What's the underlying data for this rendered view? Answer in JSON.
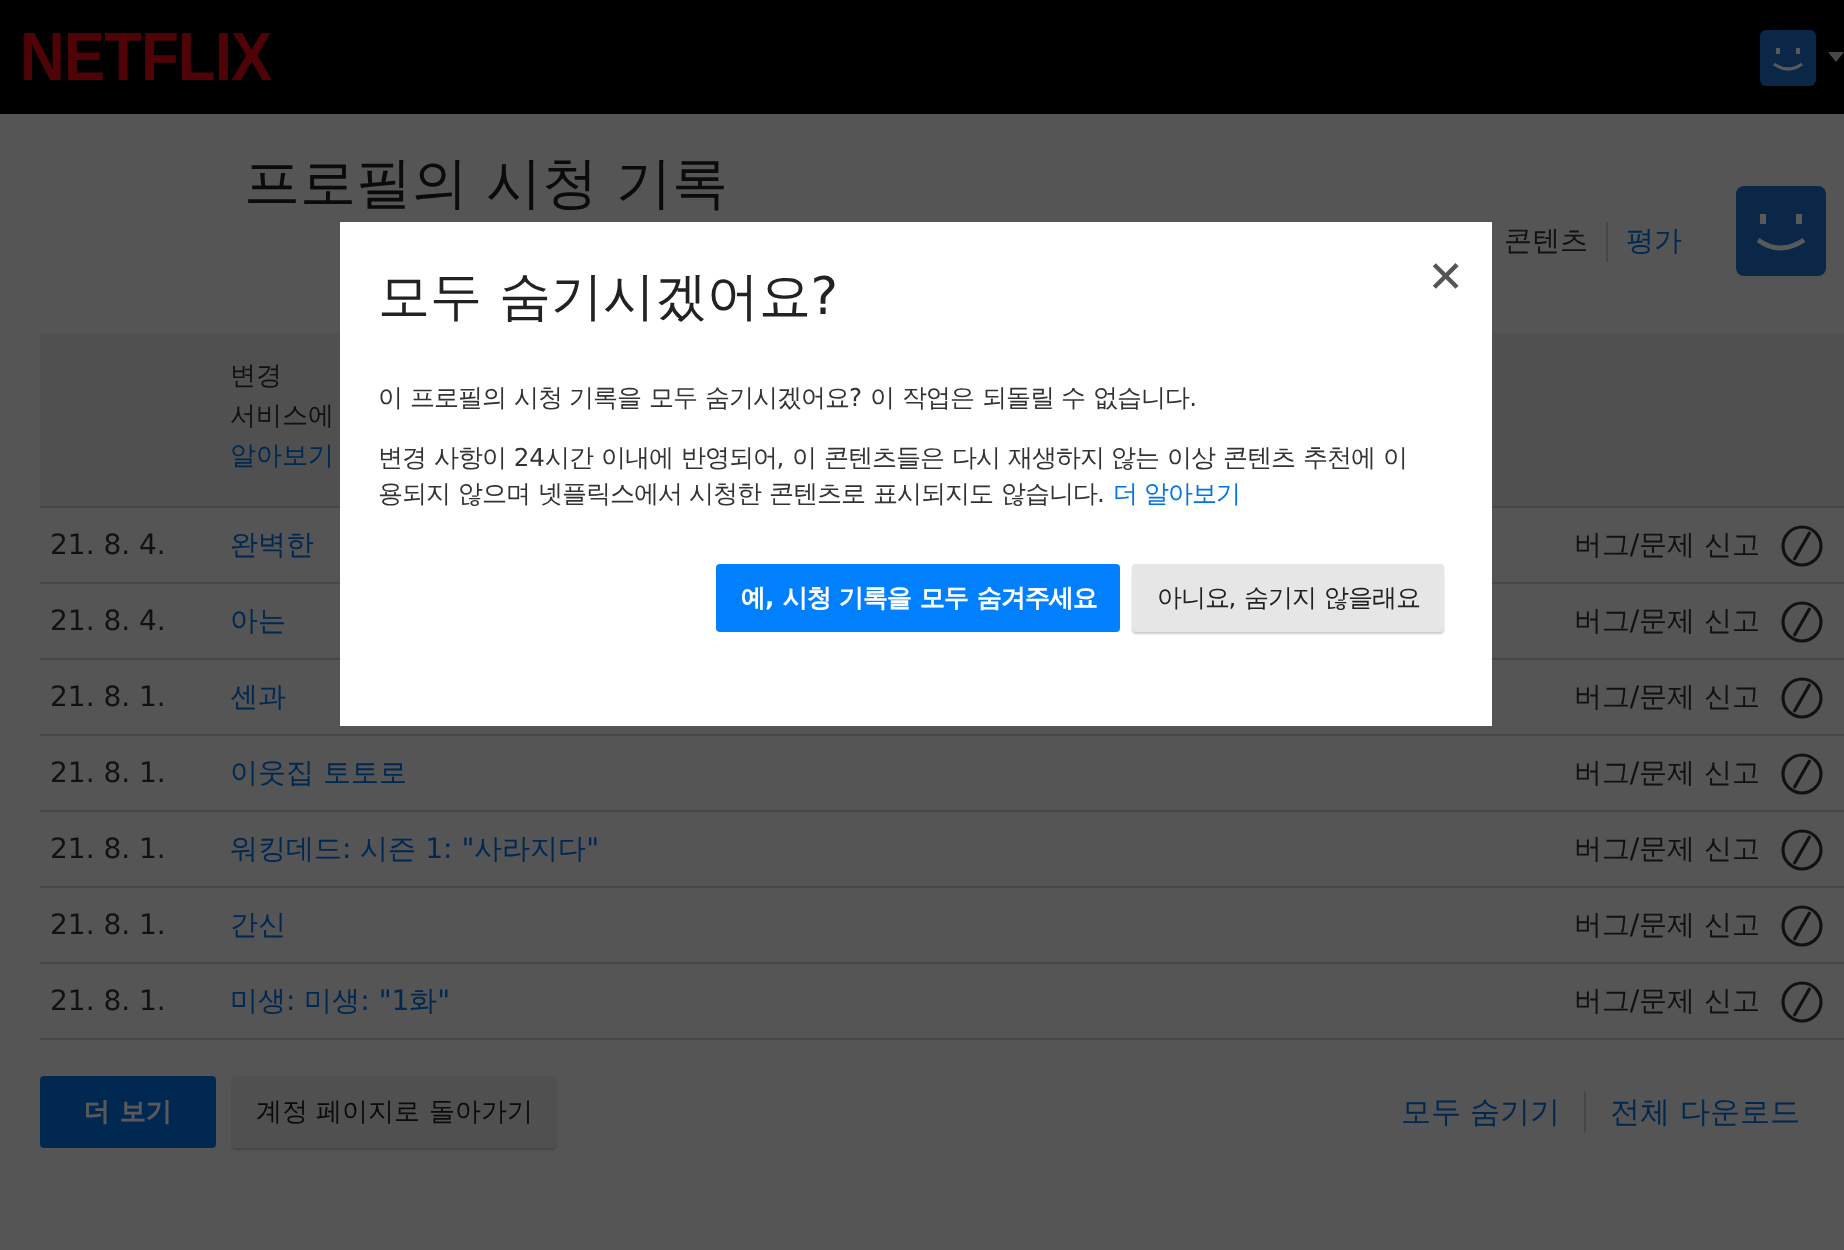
{
  "header": {
    "logo": "NETFLIX"
  },
  "page": {
    "title": "프로필의 시청 기록",
    "links": [
      "콘텐츠",
      "평가"
    ]
  },
  "banner": {
    "lines": [
      "변경",
      "서비스에",
      "알아보기"
    ]
  },
  "rows": [
    {
      "date": "21. 8. 4.",
      "title": "완벽한",
      "report": "버그/문제 신고"
    },
    {
      "date": "21. 8. 4.",
      "title": "아는",
      "report": "버그/문제 신고"
    },
    {
      "date": "21. 8. 1.",
      "title": "센과",
      "report": "버그/문제 신고"
    },
    {
      "date": "21. 8. 1.",
      "title": "이웃집 토토로",
      "report": "버그/문제 신고"
    },
    {
      "date": "21. 8. 1.",
      "title": "워킹데드: 시즌 1: \"사라지다\"",
      "report": "버그/문제 신고"
    },
    {
      "date": "21. 8. 1.",
      "title": "간신",
      "report": "버그/문제 신고"
    },
    {
      "date": "21. 8. 1.",
      "title": "미생: 미생: \"1화\"",
      "report": "버그/문제 신고"
    }
  ],
  "footer": {
    "buttons": [
      {
        "label": "더 보기",
        "kind": "primary"
      },
      {
        "label": "계정 페이지로 돌아가기",
        "kind": "secondary"
      }
    ],
    "links": [
      "모두 숨기기",
      "전체 다운로드"
    ]
  },
  "dialog": {
    "title": "모두 숨기시겠어요?",
    "close": "✕",
    "message": "이 프로필의 시청 기록을 모두 숨기시겠어요? 이 작업은 되돌릴 수 없습니다.",
    "note": "변경 사항이 24시간 이내에 반영되어, 이 콘텐츠들은 다시 재생하지 않는 이상 콘텐츠 추천에 이용되지 않으며 넷플릭스에서 시청한 콘텐츠로 표시되지도 않습니다.",
    "note_link": "더 알아보기",
    "buttons": [
      {
        "label": "예, 시청 기록을 모두 숨겨주세요",
        "kind": "primary"
      },
      {
        "label": "아니요, 숨기지 않을래요",
        "kind": "secondary"
      }
    ]
  }
}
